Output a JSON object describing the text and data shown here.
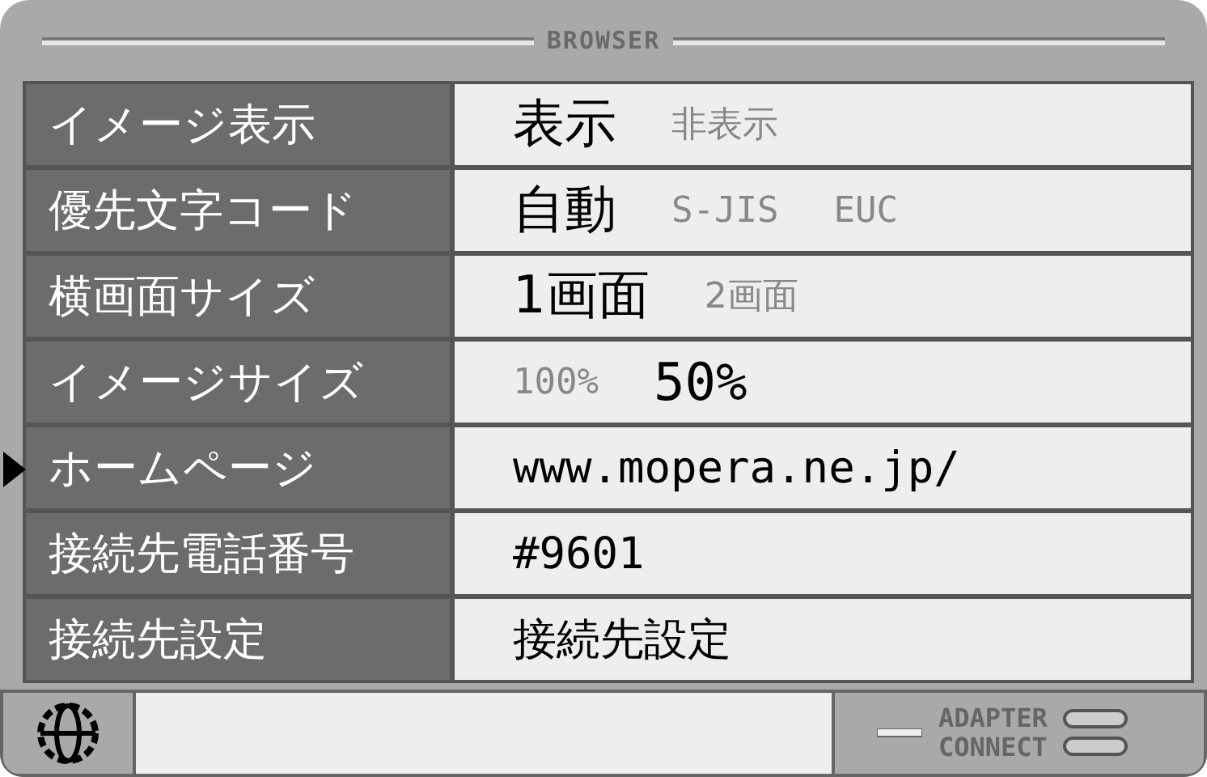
{
  "window": {
    "title": "BROWSER"
  },
  "rows": [
    {
      "label": "イメージ表示",
      "selected": false,
      "kind": "options",
      "options": [
        {
          "text": "表示",
          "selected": true
        },
        {
          "text": "非表示",
          "selected": false
        }
      ]
    },
    {
      "label": "優先文字コード",
      "selected": false,
      "kind": "options",
      "options": [
        {
          "text": "自動",
          "selected": true
        },
        {
          "text": "S-JIS",
          "selected": false
        },
        {
          "text": "EUC",
          "selected": false
        }
      ]
    },
    {
      "label": "横画面サイズ",
      "selected": false,
      "kind": "options",
      "options": [
        {
          "text": "1画面",
          "selected": true
        },
        {
          "text": "2画面",
          "selected": false
        }
      ]
    },
    {
      "label": "イメージサイズ",
      "selected": false,
      "kind": "options",
      "options": [
        {
          "text": "100%",
          "selected": false
        },
        {
          "text": "50%",
          "selected": true
        }
      ]
    },
    {
      "label": "ホームページ",
      "selected": true,
      "kind": "value",
      "value": "www.mopera.ne.jp/"
    },
    {
      "label": "接続先電話番号",
      "selected": false,
      "kind": "value",
      "value": "#9601"
    },
    {
      "label": "接続先設定",
      "selected": false,
      "kind": "value",
      "value": "接続先設定"
    }
  ],
  "status": {
    "adapter_label": "ADAPTER",
    "connect_label": "CONNECT"
  }
}
